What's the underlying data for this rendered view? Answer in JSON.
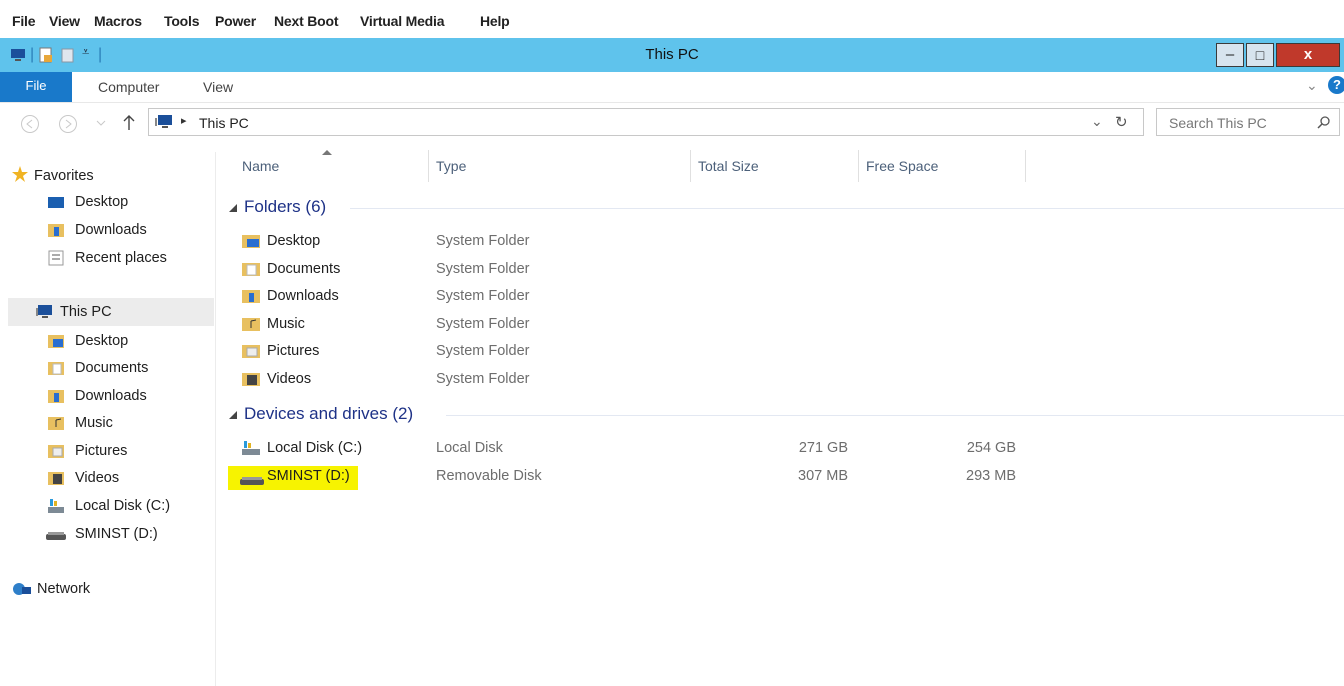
{
  "console_menu": [
    "File",
    "View",
    "Macros",
    "Tools",
    "Power",
    "Next Boot",
    "Virtual Media",
    "Help"
  ],
  "window": {
    "title": "This PC",
    "minimize": "–",
    "maximize": "□",
    "close": "x"
  },
  "ribbon": {
    "tabs": [
      "File",
      "Computer",
      "View"
    ],
    "expand": "⌄",
    "help": "?"
  },
  "address": {
    "path_root_icon": "computer-icon",
    "separator": "▸",
    "path": "This PC",
    "dropdown": "⌄",
    "refresh": "↻"
  },
  "search": {
    "placeholder": "Search This PC"
  },
  "nav": {
    "favorites": {
      "label": "Favorites",
      "items": [
        "Desktop",
        "Downloads",
        "Recent places"
      ]
    },
    "this_pc": {
      "label": "This PC",
      "items": [
        "Desktop",
        "Documents",
        "Downloads",
        "Music",
        "Pictures",
        "Videos",
        "Local Disk (C:)",
        "SMINST (D:)"
      ]
    },
    "network": {
      "label": "Network"
    }
  },
  "columns": [
    "Name",
    "Type",
    "Total Size",
    "Free Space"
  ],
  "groups": {
    "folders": {
      "label": "Folders (6)",
      "items": [
        {
          "name": "Desktop",
          "type": "System Folder"
        },
        {
          "name": "Documents",
          "type": "System Folder"
        },
        {
          "name": "Downloads",
          "type": "System Folder"
        },
        {
          "name": "Music",
          "type": "System Folder"
        },
        {
          "name": "Pictures",
          "type": "System Folder"
        },
        {
          "name": "Videos",
          "type": "System Folder"
        }
      ]
    },
    "drives": {
      "label": "Devices and drives (2)",
      "items": [
        {
          "name": "Local Disk (C:)",
          "type": "Local Disk",
          "total": "271 GB",
          "free": "254 GB"
        },
        {
          "name": "SMINST (D:)",
          "type": "Removable Disk",
          "total": "307 MB",
          "free": "293 MB",
          "highlighted": true
        }
      ]
    }
  },
  "colors": {
    "titlebar": "#5fc3ec",
    "file_tab": "#1979ca",
    "close": "#c0392b",
    "highlight": "#f7f300",
    "group_text": "#1e3287"
  }
}
